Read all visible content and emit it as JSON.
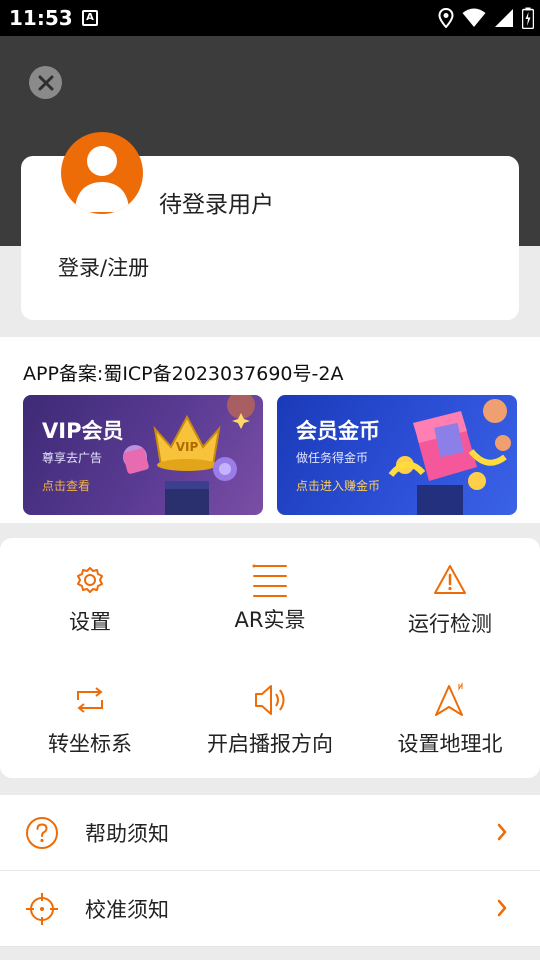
{
  "status_bar": {
    "time": "11:53",
    "notification_glyph": "A",
    "icons": [
      "location-icon",
      "wifi-icon",
      "cellular-signal-icon",
      "battery-icon"
    ]
  },
  "header": {
    "close_icon": "close-icon"
  },
  "user": {
    "name": "待登录用户",
    "login_label": "登录/注册"
  },
  "icp": {
    "text": "APP备案:蜀ICP备2023037690号-2A"
  },
  "banners": [
    {
      "title": "VIP会员",
      "subtitle": "尊享去广告",
      "cta": "点击查看",
      "art_text": "VIP"
    },
    {
      "title": "会员金币",
      "subtitle": "做任务得金币",
      "cta": "点击进入赚金币"
    }
  ],
  "features": [
    {
      "label": "设置",
      "icon": "gear-icon"
    },
    {
      "label": "AR实景",
      "icon": "list-lines-icon"
    },
    {
      "label": "运行检测",
      "icon": "warning-icon"
    },
    {
      "label": "转坐标系",
      "icon": "rotate-arrows-icon"
    },
    {
      "label": "开启播报方向",
      "icon": "speaker-icon"
    },
    {
      "label": "设置地理北",
      "icon": "north-arrow-icon"
    }
  ],
  "menu": [
    {
      "label": "帮助须知",
      "icon": "help-icon"
    },
    {
      "label": "校准须知",
      "icon": "crosshair-icon"
    }
  ],
  "colors": {
    "accent": "#ee6c08",
    "header_bg": "#3c3c3c",
    "page_bg": "#ebebeb"
  }
}
